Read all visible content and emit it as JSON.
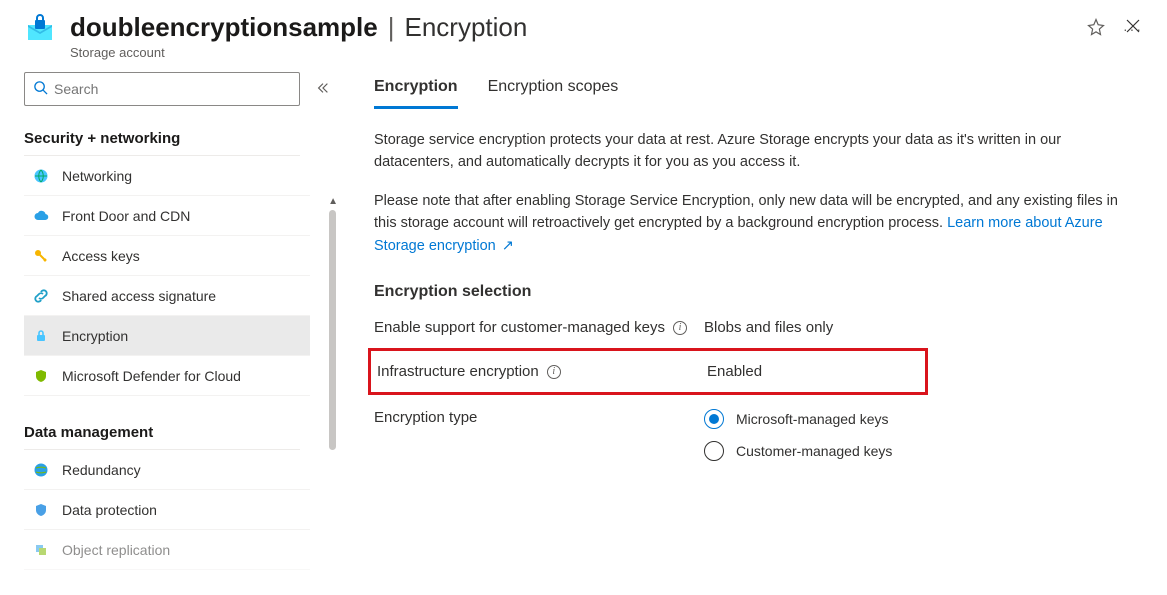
{
  "header": {
    "resource_name": "doubleencryptionsample",
    "separator": "|",
    "page": "Encryption",
    "subtitle": "Storage account"
  },
  "search": {
    "placeholder": "Search"
  },
  "sidebar": {
    "groups": [
      {
        "title": "Security + networking",
        "items": [
          {
            "key": "networking",
            "label": "Networking"
          },
          {
            "key": "front-door-cdn",
            "label": "Front Door and CDN"
          },
          {
            "key": "access-keys",
            "label": "Access keys"
          },
          {
            "key": "sas",
            "label": "Shared access signature"
          },
          {
            "key": "encryption",
            "label": "Encryption"
          },
          {
            "key": "defender",
            "label": "Microsoft Defender for Cloud"
          }
        ]
      },
      {
        "title": "Data management",
        "items": [
          {
            "key": "redundancy",
            "label": "Redundancy"
          },
          {
            "key": "data-protection",
            "label": "Data protection"
          },
          {
            "key": "object-replication",
            "label": "Object replication"
          }
        ]
      }
    ],
    "selected": "encryption"
  },
  "tabs": {
    "items": [
      {
        "key": "encryption",
        "label": "Encryption"
      },
      {
        "key": "scopes",
        "label": "Encryption scopes"
      }
    ],
    "active": "encryption"
  },
  "description": {
    "p1": "Storage service encryption protects your data at rest. Azure Storage encrypts your data as it's written in our datacenters, and automatically decrypts it for you as you access it.",
    "p2_pre": "Please note that after enabling Storage Service Encryption, only new data will be encrypted, and any existing files in this storage account will retroactively get encrypted by a background encryption process. ",
    "link": "Learn more about Azure Storage encryption"
  },
  "section": {
    "title": "Encryption selection",
    "cmk_label": "Enable support for customer-managed keys",
    "cmk_value": "Blobs and files only",
    "infra_label": "Infrastructure encryption",
    "infra_value": "Enabled",
    "type_label": "Encryption type",
    "type_options": [
      {
        "key": "mmk",
        "label": "Microsoft-managed keys"
      },
      {
        "key": "cmk",
        "label": "Customer-managed keys"
      }
    ],
    "type_selected": "mmk"
  }
}
